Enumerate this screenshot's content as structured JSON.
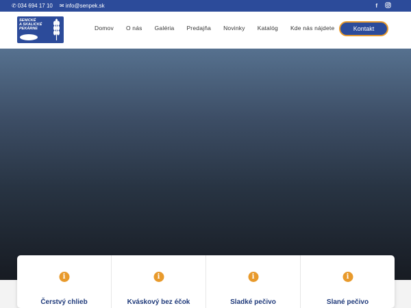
{
  "topbar": {
    "phone": "034 694 17 10",
    "email": "info@senpek.sk",
    "social": [
      "facebook-icon",
      "instagram-icon"
    ]
  },
  "logo": {
    "text_line1": "SENICKÉ",
    "text_line2": "A SKALICKÉ",
    "text_line3": "PEKÁRNE"
  },
  "nav": {
    "items": [
      {
        "label": "Domov"
      },
      {
        "label": "O nás"
      },
      {
        "label": "Galéria"
      },
      {
        "label": "Predajňa"
      },
      {
        "label": "Novinky"
      },
      {
        "label": "Katalóg"
      },
      {
        "label": "Kde nás nájdete"
      }
    ],
    "cta": "Kontakt"
  },
  "cards": [
    {
      "title": "Čerstvý chlieb",
      "icon": "info-icon"
    },
    {
      "title": "Kváskový bez éčok",
      "icon": "info-icon"
    },
    {
      "title": "Sladké pečivo",
      "icon": "info-icon"
    },
    {
      "title": "Slané pečivo",
      "icon": "info-icon"
    }
  ],
  "colors": {
    "brand": "#2c4b9a",
    "accent": "#e89a2c"
  }
}
